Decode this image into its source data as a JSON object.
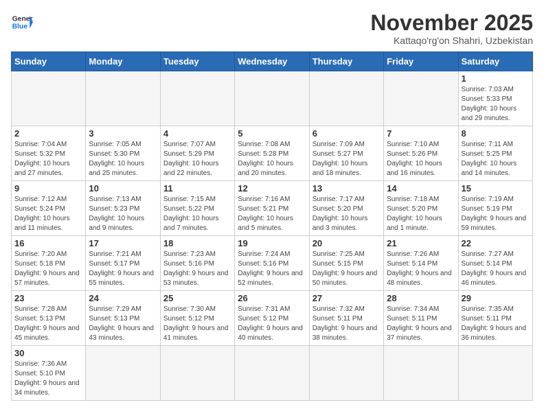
{
  "header": {
    "logo_general": "General",
    "logo_blue": "Blue",
    "title": "November 2025",
    "subtitle": "Kattaqo'rg'on Shahri, Uzbekistan"
  },
  "days_of_week": [
    "Sunday",
    "Monday",
    "Tuesday",
    "Wednesday",
    "Thursday",
    "Friday",
    "Saturday"
  ],
  "weeks": [
    [
      {
        "day": "",
        "info": ""
      },
      {
        "day": "",
        "info": ""
      },
      {
        "day": "",
        "info": ""
      },
      {
        "day": "",
        "info": ""
      },
      {
        "day": "",
        "info": ""
      },
      {
        "day": "",
        "info": ""
      },
      {
        "day": "1",
        "info": "Sunrise: 7:03 AM\nSunset: 5:33 PM\nDaylight: 10 hours and 29 minutes."
      }
    ],
    [
      {
        "day": "2",
        "info": "Sunrise: 7:04 AM\nSunset: 5:32 PM\nDaylight: 10 hours and 27 minutes."
      },
      {
        "day": "3",
        "info": "Sunrise: 7:05 AM\nSunset: 5:30 PM\nDaylight: 10 hours and 25 minutes."
      },
      {
        "day": "4",
        "info": "Sunrise: 7:07 AM\nSunset: 5:29 PM\nDaylight: 10 hours and 22 minutes."
      },
      {
        "day": "5",
        "info": "Sunrise: 7:08 AM\nSunset: 5:28 PM\nDaylight: 10 hours and 20 minutes."
      },
      {
        "day": "6",
        "info": "Sunrise: 7:09 AM\nSunset: 5:27 PM\nDaylight: 10 hours and 18 minutes."
      },
      {
        "day": "7",
        "info": "Sunrise: 7:10 AM\nSunset: 5:26 PM\nDaylight: 10 hours and 16 minutes."
      },
      {
        "day": "8",
        "info": "Sunrise: 7:11 AM\nSunset: 5:25 PM\nDaylight: 10 hours and 14 minutes."
      }
    ],
    [
      {
        "day": "9",
        "info": "Sunrise: 7:12 AM\nSunset: 5:24 PM\nDaylight: 10 hours and 11 minutes."
      },
      {
        "day": "10",
        "info": "Sunrise: 7:13 AM\nSunset: 5:23 PM\nDaylight: 10 hours and 9 minutes."
      },
      {
        "day": "11",
        "info": "Sunrise: 7:15 AM\nSunset: 5:22 PM\nDaylight: 10 hours and 7 minutes."
      },
      {
        "day": "12",
        "info": "Sunrise: 7:16 AM\nSunset: 5:21 PM\nDaylight: 10 hours and 5 minutes."
      },
      {
        "day": "13",
        "info": "Sunrise: 7:17 AM\nSunset: 5:20 PM\nDaylight: 10 hours and 3 minutes."
      },
      {
        "day": "14",
        "info": "Sunrise: 7:18 AM\nSunset: 5:20 PM\nDaylight: 10 hours and 1 minute."
      },
      {
        "day": "15",
        "info": "Sunrise: 7:19 AM\nSunset: 5:19 PM\nDaylight: 9 hours and 59 minutes."
      }
    ],
    [
      {
        "day": "16",
        "info": "Sunrise: 7:20 AM\nSunset: 5:18 PM\nDaylight: 9 hours and 57 minutes."
      },
      {
        "day": "17",
        "info": "Sunrise: 7:21 AM\nSunset: 5:17 PM\nDaylight: 9 hours and 55 minutes."
      },
      {
        "day": "18",
        "info": "Sunrise: 7:23 AM\nSunset: 5:16 PM\nDaylight: 9 hours and 53 minutes."
      },
      {
        "day": "19",
        "info": "Sunrise: 7:24 AM\nSunset: 5:16 PM\nDaylight: 9 hours and 52 minutes."
      },
      {
        "day": "20",
        "info": "Sunrise: 7:25 AM\nSunset: 5:15 PM\nDaylight: 9 hours and 50 minutes."
      },
      {
        "day": "21",
        "info": "Sunrise: 7:26 AM\nSunset: 5:14 PM\nDaylight: 9 hours and 48 minutes."
      },
      {
        "day": "22",
        "info": "Sunrise: 7:27 AM\nSunset: 5:14 PM\nDaylight: 9 hours and 46 minutes."
      }
    ],
    [
      {
        "day": "23",
        "info": "Sunrise: 7:28 AM\nSunset: 5:13 PM\nDaylight: 9 hours and 45 minutes."
      },
      {
        "day": "24",
        "info": "Sunrise: 7:29 AM\nSunset: 5:13 PM\nDaylight: 9 hours and 43 minutes."
      },
      {
        "day": "25",
        "info": "Sunrise: 7:30 AM\nSunset: 5:12 PM\nDaylight: 9 hours and 41 minutes."
      },
      {
        "day": "26",
        "info": "Sunrise: 7:31 AM\nSunset: 5:12 PM\nDaylight: 9 hours and 40 minutes."
      },
      {
        "day": "27",
        "info": "Sunrise: 7:32 AM\nSunset: 5:11 PM\nDaylight: 9 hours and 38 minutes."
      },
      {
        "day": "28",
        "info": "Sunrise: 7:34 AM\nSunset: 5:11 PM\nDaylight: 9 hours and 37 minutes."
      },
      {
        "day": "29",
        "info": "Sunrise: 7:35 AM\nSunset: 5:11 PM\nDaylight: 9 hours and 36 minutes."
      }
    ],
    [
      {
        "day": "30",
        "info": "Sunrise: 7:36 AM\nSunset: 5:10 PM\nDaylight: 9 hours and 34 minutes."
      },
      {
        "day": "",
        "info": ""
      },
      {
        "day": "",
        "info": ""
      },
      {
        "day": "",
        "info": ""
      },
      {
        "day": "",
        "info": ""
      },
      {
        "day": "",
        "info": ""
      },
      {
        "day": "",
        "info": ""
      }
    ]
  ]
}
